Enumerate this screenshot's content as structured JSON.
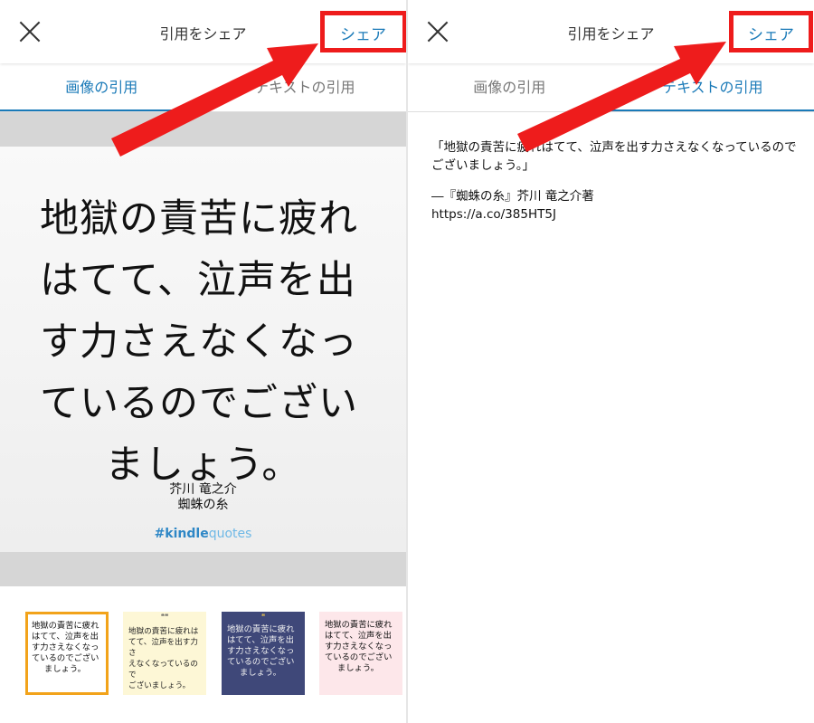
{
  "left_panel": {
    "header": {
      "title": "引用をシェア",
      "share_label": "シェア"
    },
    "tabs": [
      {
        "label": "画像の引用",
        "active": true
      },
      {
        "label": "テキストの引用",
        "active": false
      }
    ],
    "quote_card": {
      "quote_lines": [
        "地獄の責苦に疲れ",
        "はてて、泣声を出",
        "す力さえなくなっ",
        "ているのでござい",
        "ましょう。"
      ],
      "author": "芥川 竜之介",
      "book": "蜘蛛の糸",
      "hashtag_part1": "#kindle",
      "hashtag_part2": "quotes"
    },
    "thumbnails": [
      {
        "lines": [
          "地獄の責苦に疲れ",
          "はてて、泣声を出",
          "す力さえなくなっ",
          "ているのでござい",
          "ましょう。"
        ],
        "background": "#ffffff",
        "text_color": "#111111",
        "selected": true
      },
      {
        "lines": [
          "地獄の責苦に疲れは",
          "てて、泣声を出す力さ",
          "えなくなっているので",
          "ございましょう。"
        ],
        "background": "#fdf7d6",
        "text_color": "#222222",
        "selected": false
      },
      {
        "lines": [
          "地獄の責苦に疲れ",
          "はてて、泣声を出",
          "す力さえなくなっ",
          "ているのでござい",
          "ましょう。"
        ],
        "background": "#3f4879",
        "text_color": "#f2f2f2",
        "selected": false
      },
      {
        "lines": [
          "地獄の責苦に疲れ",
          "はてて、泣声を出",
          "す力さえなくなっ",
          "ているのでござい",
          "ましょう。"
        ],
        "background": "#fde7ea",
        "text_color": "#111111",
        "selected": false
      }
    ]
  },
  "right_panel": {
    "header": {
      "title": "引用をシェア",
      "share_label": "シェア"
    },
    "tabs": [
      {
        "label": "画像の引用",
        "active": false
      },
      {
        "label": "テキストの引用",
        "active": true
      }
    ],
    "text_quote": {
      "quote": "「地獄の責苦に疲れはてて、泣声を出す力さえなくなっているのでございましょう。」",
      "attribution": "―『蜘蛛の糸』芥川 竜之介著",
      "link": "https://a.co/385HT5J"
    }
  },
  "colors": {
    "accent": "#1a7ab8",
    "highlight": "#ee1c1c",
    "selected_thumb": "#f2a31a"
  }
}
